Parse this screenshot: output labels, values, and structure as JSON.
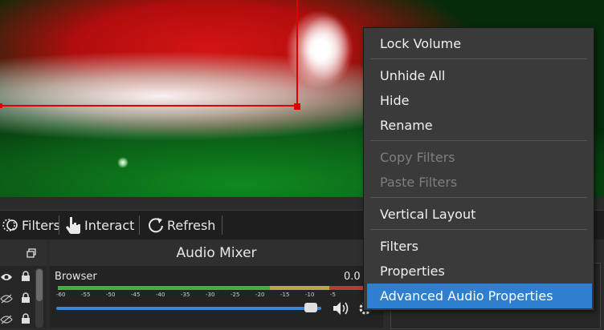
{
  "toolbar": {
    "filters_label": "Filters",
    "interact_label": "Interact",
    "refresh_label": "Refresh"
  },
  "mixer": {
    "title": "Audio Mixer",
    "track_name": "Browser",
    "track_db": "0.0",
    "ticks": [
      "-60",
      "-55",
      "-50",
      "-45",
      "-40",
      "-35",
      "-30",
      "-25",
      "-20",
      "-15",
      "-10",
      "-5"
    ],
    "volume_level": 0.96
  },
  "context_menu": {
    "items": [
      {
        "label": "Lock Volume",
        "disabled": false
      },
      {
        "label": "Unhide All",
        "disabled": false
      },
      {
        "label": "Hide",
        "disabled": false
      },
      {
        "label": "Rename",
        "disabled": false
      },
      {
        "label": "Copy Filters",
        "disabled": true
      },
      {
        "label": "Paste Filters",
        "disabled": true
      },
      {
        "label": "Vertical Layout",
        "disabled": false
      },
      {
        "label": "Filters",
        "disabled": false
      },
      {
        "label": "Properties",
        "disabled": false
      },
      {
        "label": "Advanced Audio Properties",
        "disabled": false,
        "highlighted": true
      }
    ]
  },
  "colors": {
    "accent": "#2f7fd0",
    "selection": "#e00000",
    "meter_green": "#4ca84c",
    "meter_yellow": "#b8a83a",
    "meter_red": "#b83a3a"
  }
}
